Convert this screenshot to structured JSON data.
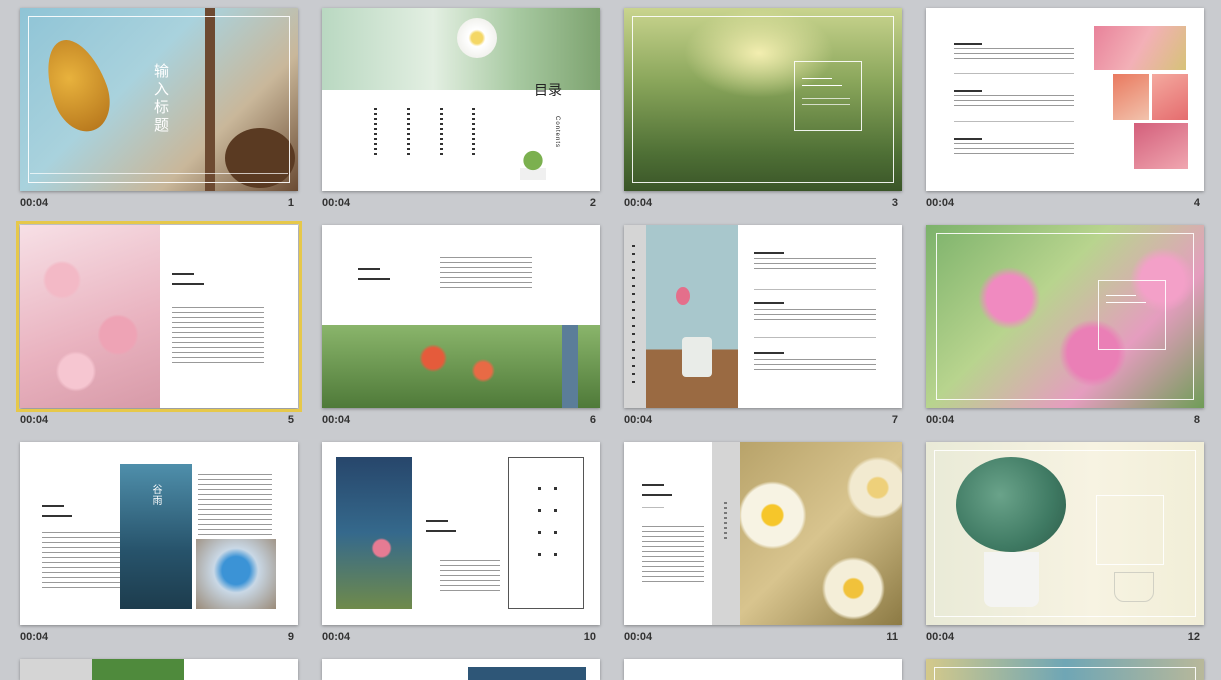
{
  "slides": [
    {
      "time": "00:04",
      "num": "1"
    },
    {
      "time": "00:04",
      "num": "2"
    },
    {
      "time": "00:04",
      "num": "3"
    },
    {
      "time": "00:04",
      "num": "4"
    },
    {
      "time": "00:04",
      "num": "5",
      "selected": true
    },
    {
      "time": "00:04",
      "num": "6"
    },
    {
      "time": "00:04",
      "num": "7"
    },
    {
      "time": "00:04",
      "num": "8"
    },
    {
      "time": "00:04",
      "num": "9"
    },
    {
      "time": "00:04",
      "num": "10"
    },
    {
      "time": "00:04",
      "num": "11"
    },
    {
      "time": "00:04",
      "num": "12"
    }
  ],
  "text": {
    "s1_title": "输入标题",
    "s2_title": "目录",
    "s2_sub": "Contents",
    "s9_rain": "谷雨"
  },
  "colors": {
    "background": "#c9cbcf",
    "selected_outline": "#e6c84a"
  }
}
